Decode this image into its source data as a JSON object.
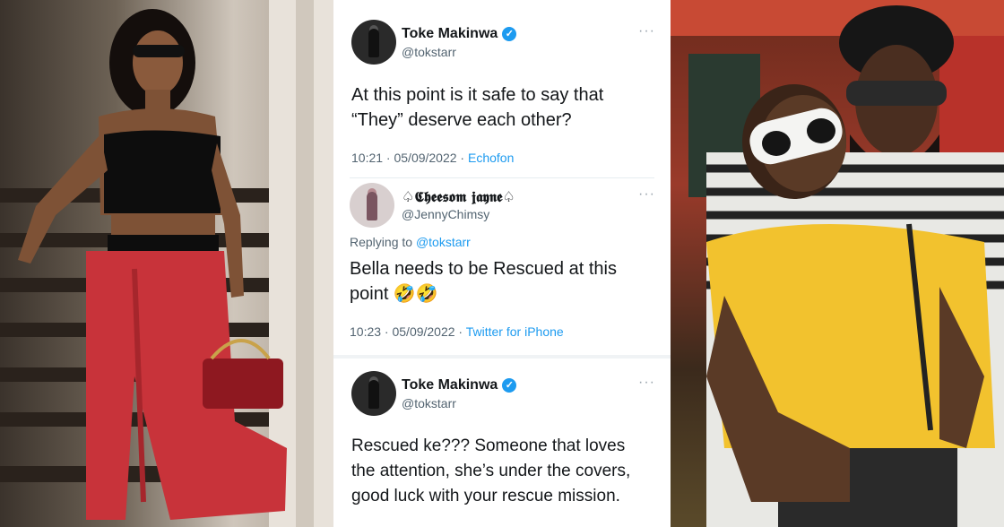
{
  "tweets": [
    {
      "name": "Toke Makinwa",
      "handle": "@tokstarr",
      "verified": true,
      "body": "At this point is it safe to say that “They” deserve each other?",
      "time": "10:21 · 05/09/2022 · ",
      "source": "Echofon"
    },
    {
      "name": "♤𝕮𝖍𝖊𝖊𝖘𝖔𝖒 𝖏𝖆𝖞𝖓𝖊♤",
      "handle": "@JennyChimsy",
      "verified": false,
      "reply_prefix": "Replying to ",
      "reply_to": "@tokstarr",
      "body": "Bella needs to be Rescued at this point 🤣🤣",
      "time": "10:23 · 05/09/2022 · ",
      "source": "Twitter for iPhone"
    },
    {
      "name": "Toke Makinwa",
      "handle": "@tokstarr",
      "verified": true,
      "body": "Rescued ke??? Someone that loves the attention, she’s under the covers, good luck with your rescue mission.",
      "time": "",
      "source": ""
    }
  ],
  "more_icon": "···",
  "verified_icon": "✓",
  "colors": {
    "accent": "#1d9bf0",
    "text": "#14171a",
    "muted": "#536471"
  }
}
